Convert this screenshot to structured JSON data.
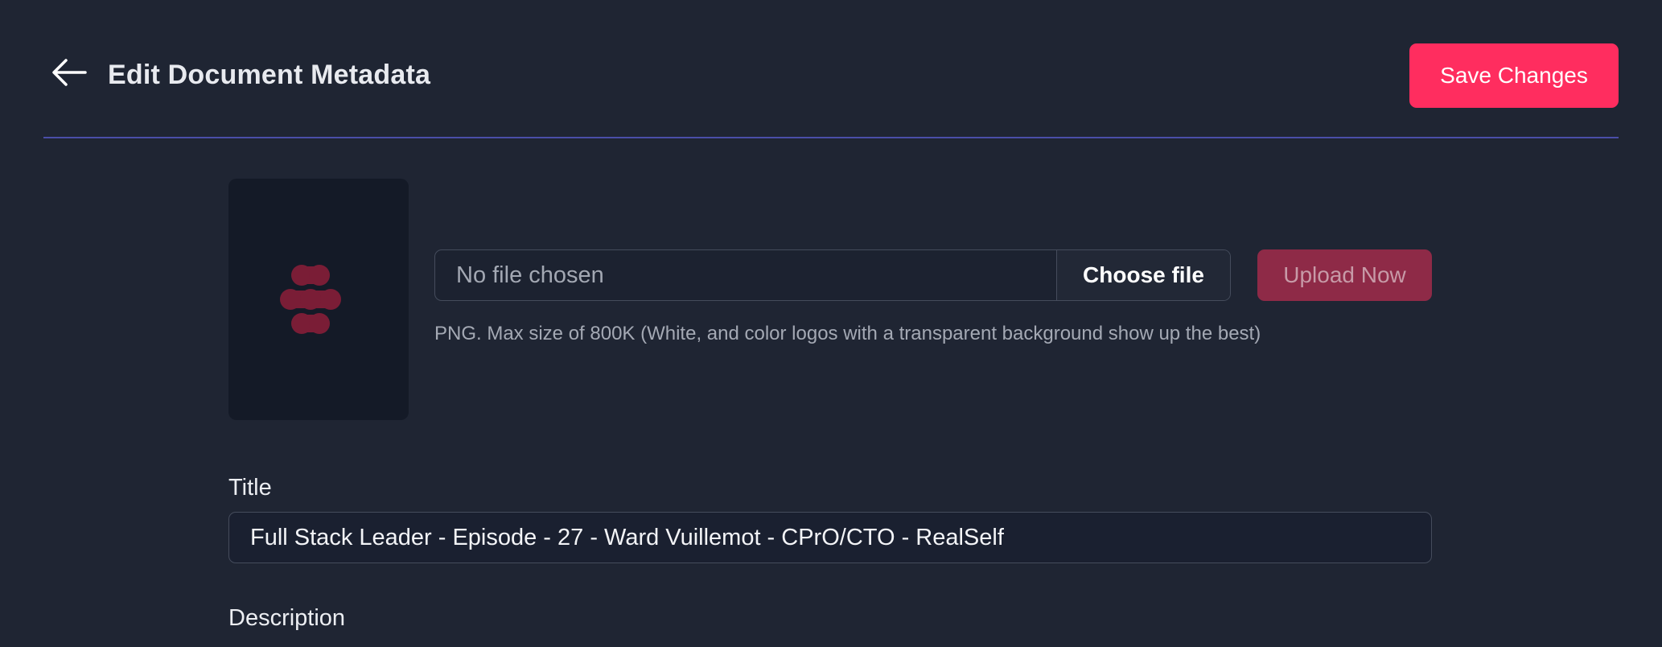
{
  "header": {
    "back_icon": "arrow-left-icon",
    "title": "Edit Document Metadata",
    "save_label": "Save Changes"
  },
  "logo": {
    "icon": "logo-dots-icon",
    "color": "#7a1d36",
    "background": "#141a27"
  },
  "upload": {
    "file_status": "No file chosen",
    "choose_label": "Choose file",
    "upload_label": "Upload Now",
    "hint": "PNG. Max size of 800K (White, and color logos with a transparent background show up the best)"
  },
  "form": {
    "title_label": "Title",
    "title_value": "Full Stack Leader - Episode - 27 - Ward Vuillemot - CPrO/CTO - RealSelf",
    "description_label": "Description"
  },
  "colors": {
    "background": "#1f2533",
    "accent": "#ff2d5f",
    "accent_disabled": "#8e2a47",
    "divider": "#4a4ea8"
  }
}
